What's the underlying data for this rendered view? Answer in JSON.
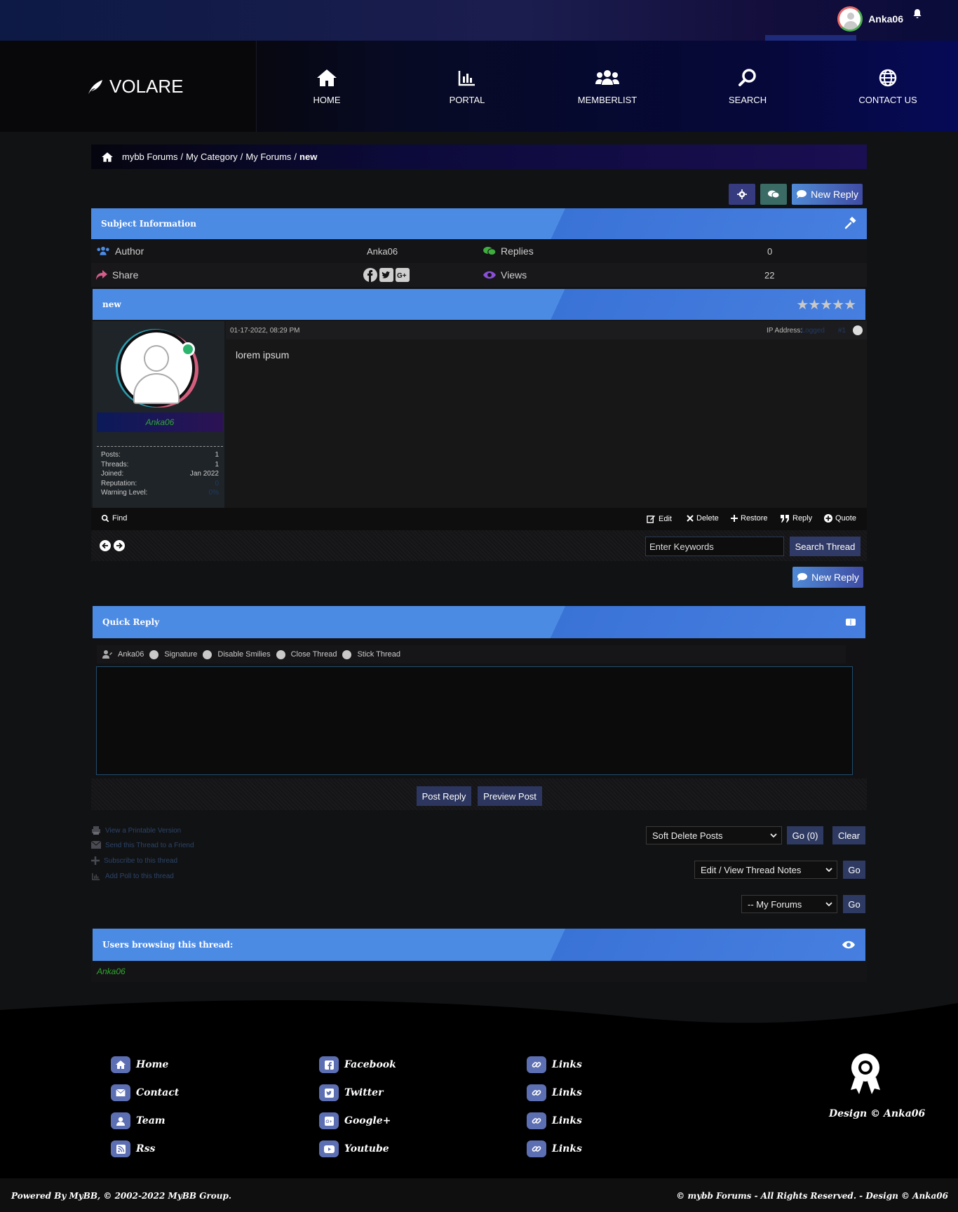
{
  "topbar": {
    "username": "Anka06"
  },
  "brand": {
    "name": "VOLARE"
  },
  "nav": [
    {
      "label": "HOME",
      "icon": "home-icon"
    },
    {
      "label": "PORTAL",
      "icon": "chart-icon"
    },
    {
      "label": "MEMBERLIST",
      "icon": "users-icon"
    },
    {
      "label": "SEARCH",
      "icon": "search-icon"
    },
    {
      "label": "CONTACT US",
      "icon": "globe-icon"
    }
  ],
  "breadcrumb": {
    "items": [
      "mybb Forums",
      "My Category",
      "My Forums"
    ],
    "current": "new",
    "sep": "/"
  },
  "actions": {
    "new_reply": "New Reply"
  },
  "subject_info": {
    "title": "Subject Information",
    "author_label": "Author",
    "author_value": "Anka06",
    "replies_label": "Replies",
    "replies_value": "0",
    "share_label": "Share",
    "views_label": "Views",
    "views_value": "22"
  },
  "post": {
    "thread_title": "new",
    "rating_stars": "★★★★★",
    "date": "01-17-2022, 08:29 PM",
    "ip_label": "IP Address:",
    "ip_value": "Logged",
    "post_number": "#1",
    "body": "lorem ipsum",
    "author": "Anka06",
    "stats": [
      {
        "label": "Posts:",
        "value": "1"
      },
      {
        "label": "Threads:",
        "value": "1"
      },
      {
        "label": "Joined:",
        "value": "Jan 2022"
      },
      {
        "label": "Reputation:",
        "value": "0"
      },
      {
        "label": "Warning Level:",
        "value": "0%"
      }
    ],
    "find": "Find",
    "edit": "Edit",
    "delete": "Delete",
    "restore": "Restore",
    "reply": "Reply",
    "quote": "Quote"
  },
  "thread_search": {
    "placeholder": "Enter Keywords",
    "button": "Search Thread"
  },
  "quick_reply": {
    "title": "Quick Reply",
    "user": "Anka06",
    "opt_signature": "Signature",
    "opt_smilies": "Disable Smilies",
    "opt_close": "Close Thread",
    "opt_stick": "Stick Thread",
    "post_btn": "Post Reply",
    "preview_btn": "Preview Post"
  },
  "tools": {
    "printable": "View a Printable Version",
    "send_friend": "Send this Thread to a Friend",
    "subscribe": "Subscribe to this thread",
    "add_poll": "Add Poll to this thread"
  },
  "moderation": {
    "select1": "Soft Delete Posts",
    "go1": "Go (0)",
    "clear": "Clear",
    "select2": "Edit / View Thread Notes",
    "go2": "Go",
    "select3": "-- My Forums",
    "go3": "Go"
  },
  "browsing": {
    "title": "Users browsing this thread:",
    "user": "Anka06"
  },
  "footer": {
    "col1": [
      "Home",
      "Contact",
      "Team",
      "Rss"
    ],
    "col2": [
      "Facebook",
      "Twitter",
      "Google+",
      "Youtube"
    ],
    "col3": [
      "Links",
      "Links",
      "Links",
      "Links"
    ],
    "design": "Design © Anka06",
    "powered": "Powered By MyBB, © 2002-2022 MyBB Group.",
    "rights": "© mybb Forums - All Rights Reserved. - Design © Anka06"
  },
  "colors": {
    "accent": "#4c8be4",
    "online": "#2db56e",
    "username": "#2fa82f"
  }
}
